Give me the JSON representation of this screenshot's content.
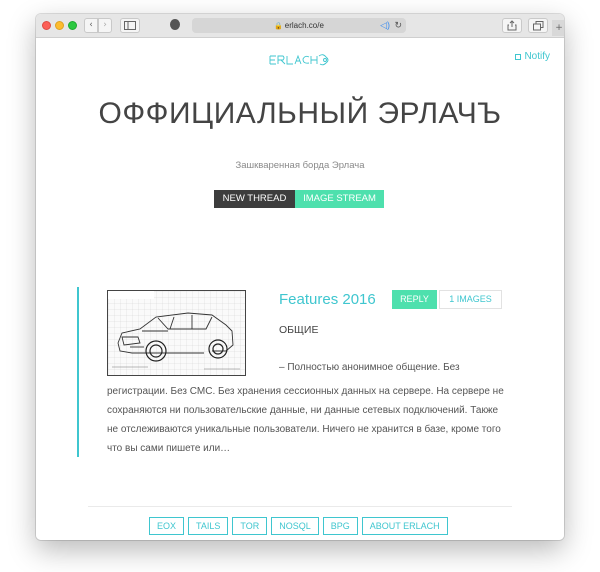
{
  "browser": {
    "url": "erlach.co/e",
    "back_glyph": "‹",
    "forward_glyph": "›",
    "lock_glyph": "🔒",
    "speaker_glyph": "◁)",
    "reload_glyph": "↻",
    "plus_glyph": "+"
  },
  "header": {
    "logo": "ERLACH",
    "notify_label": "Notify"
  },
  "board": {
    "title": "ОФФИЦИАЛЬНЫЙ ЭРЛАЧЪ",
    "subtitle": "Зашкваренная борда Эрлача",
    "new_thread_label": "NEW THREAD",
    "image_stream_label": "IMAGE STREAM"
  },
  "thread": {
    "title": "Features 2016",
    "reply_label": "REPLY",
    "images_label": "1 IMAGES",
    "subject": "ОБЩИЕ",
    "body_first": "– Полностью анонимное общение. Без",
    "body_rest": "регистрации. Без СМС. Без хранения сессионных данных на сервере. На сервере не сохраняются ни пользовательские данные, ни данные сетевых подключений. Также не отслеживаются уникальные пользователи. Ничего не хранится в базе, кроме того что вы сами пишете или…"
  },
  "footer": {
    "links": [
      "EOX",
      "TAILS",
      "TOR",
      "NOSQL",
      "BPG",
      "ABOUT ERLACH"
    ]
  },
  "colors": {
    "accent": "#3fc6cf",
    "green": "#4ee0ad",
    "dark": "#3d3d3d"
  }
}
